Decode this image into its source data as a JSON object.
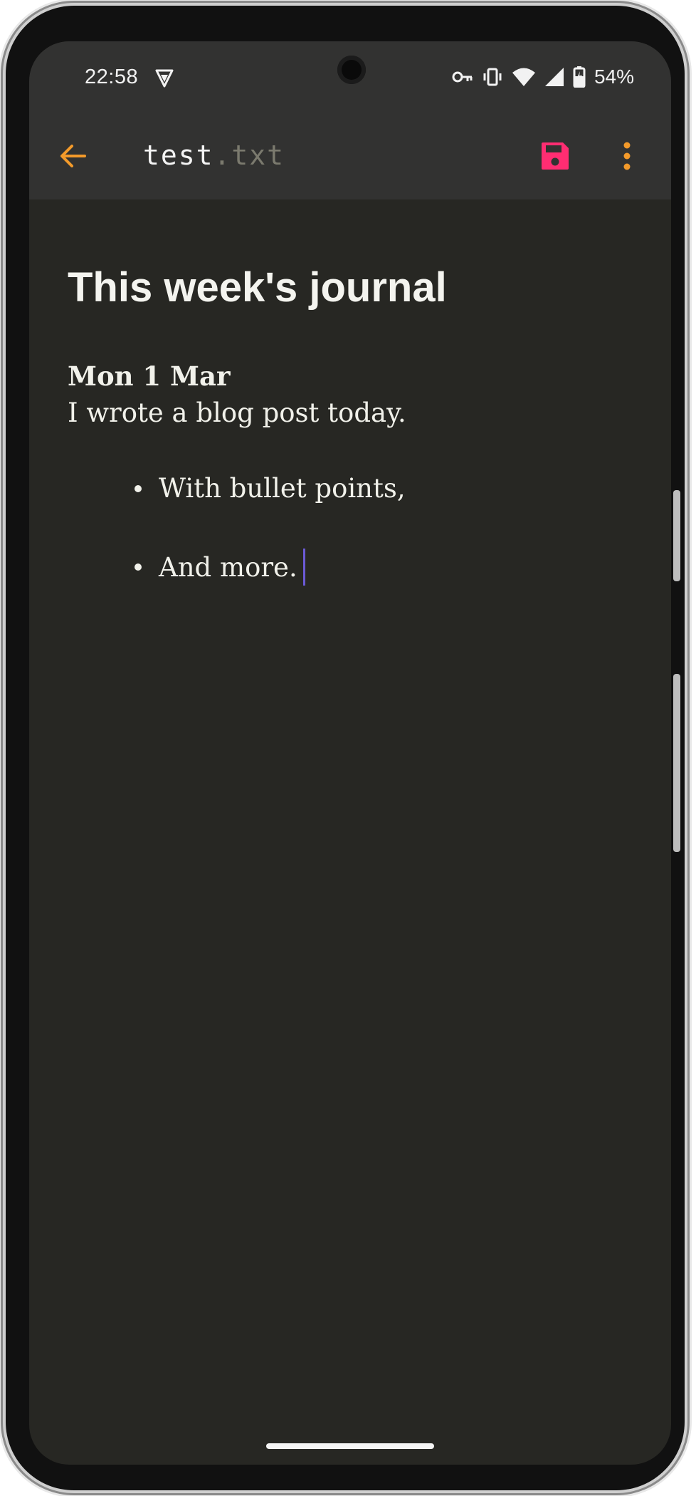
{
  "status_bar": {
    "time": "22:58",
    "battery": "54%",
    "icons": [
      "vpn-shield-icon",
      "key-icon",
      "vibrate-icon",
      "wifi-icon",
      "cell-signal-icon",
      "battery-charging-icon"
    ]
  },
  "app_bar": {
    "back_icon": "arrow-left-icon",
    "file_name": "test",
    "file_ext": ".txt",
    "save_icon": "floppy-disk-icon",
    "more_icon": "vertical-dots-icon"
  },
  "editor": {
    "title": "This week's journal",
    "date_heading": "Mon 1 Mar",
    "paragraph": "I wrote a blog post today.",
    "bullets": [
      "With bullet points,",
      "And more."
    ]
  },
  "colors": {
    "background": "#272723",
    "toolbar": "#323231",
    "accent_orange": "#f39a2a",
    "save_pink": "#ff2d72",
    "caret": "#6b5ad6"
  }
}
